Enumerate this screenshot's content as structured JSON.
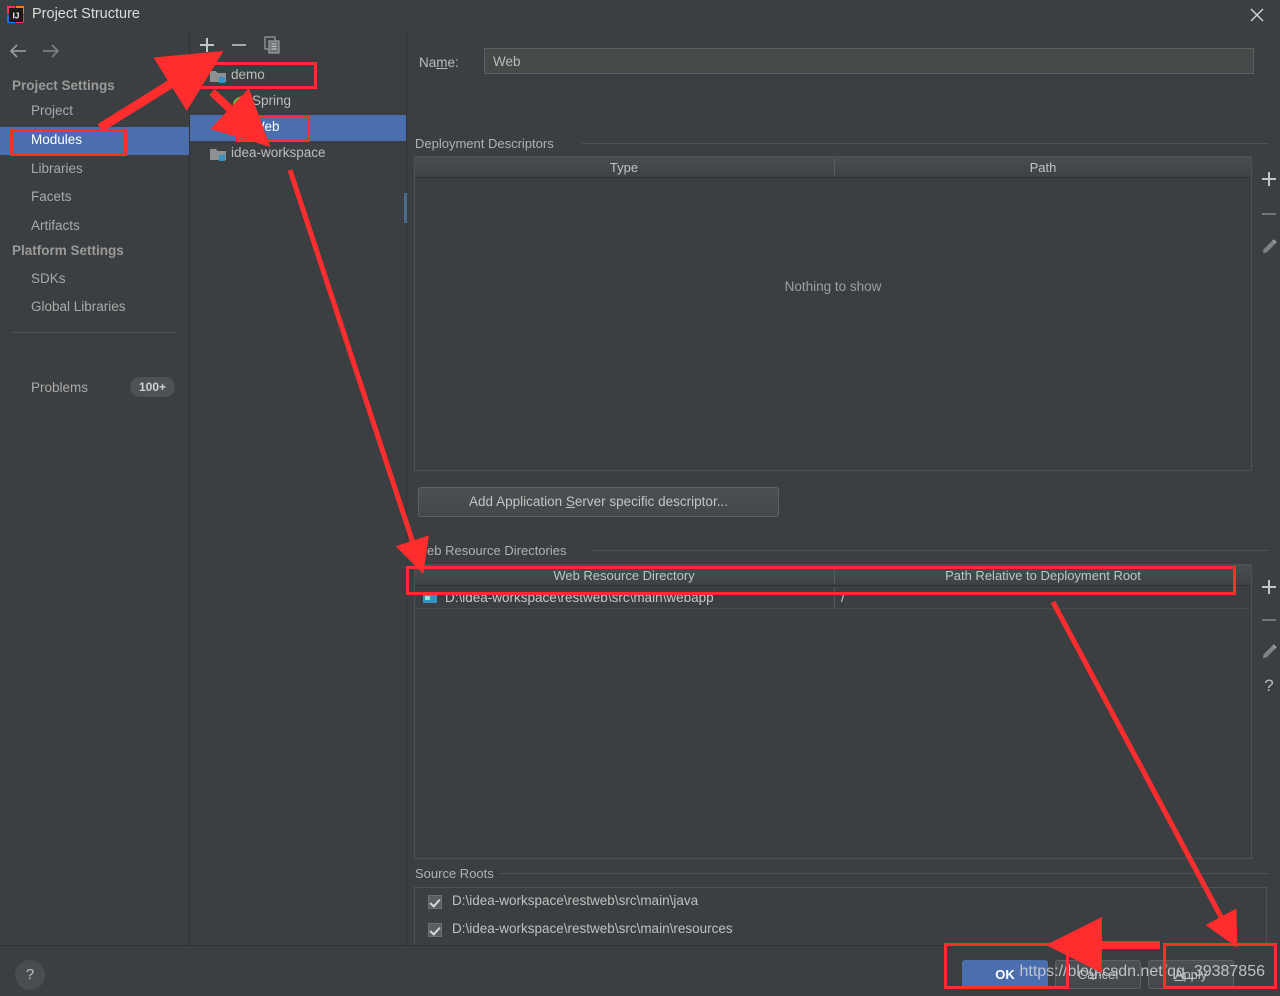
{
  "window": {
    "title": "Project Structure",
    "logo_icon": "intellij-idea-logo",
    "close_icon": "close-icon"
  },
  "sidebar": {
    "back_icon": "arrow-left-icon",
    "forward_icon": "arrow-right-icon",
    "groups": [
      {
        "label": "Project Settings"
      },
      {
        "label": "Platform Settings"
      }
    ],
    "items": [
      {
        "label": "Project",
        "selected": false
      },
      {
        "label": "Modules",
        "selected": true
      },
      {
        "label": "Libraries",
        "selected": false
      },
      {
        "label": "Facets",
        "selected": false
      },
      {
        "label": "Artifacts",
        "selected": false
      },
      {
        "label": "SDKs",
        "selected": false
      },
      {
        "label": "Global Libraries",
        "selected": false
      }
    ],
    "problems": {
      "label": "Problems",
      "count": "100+"
    }
  },
  "tree": {
    "toolbar": {
      "add_icon": "plus-icon",
      "remove_icon": "minus-icon",
      "copy_icon": "copy-icon"
    },
    "nodes": [
      {
        "label": "demo",
        "icon": "module-folder-icon",
        "expanded": true,
        "depth": 0,
        "selected": false
      },
      {
        "label": "Spring",
        "icon": "spring-leaf-icon",
        "expanded": null,
        "depth": 1,
        "selected": false
      },
      {
        "label": "Web",
        "icon": "web-facet-icon",
        "expanded": null,
        "depth": 1,
        "selected": true
      },
      {
        "label": "idea-workspace",
        "icon": "module-folder-icon",
        "expanded": null,
        "depth": 0,
        "selected": false
      }
    ]
  },
  "main": {
    "name_label": "Name:",
    "name_label_mnemonic": "m",
    "name_value": "Web",
    "deployment_descriptors": {
      "section_title": "Deployment Descriptors",
      "columns": [
        "Type",
        "Path"
      ],
      "rows": [],
      "empty_message": "Nothing to show",
      "toolbar": [
        {
          "icon": "plus-icon",
          "name": "add"
        },
        {
          "icon": "minus-icon",
          "name": "remove"
        },
        {
          "icon": "pencil-icon",
          "name": "edit"
        }
      ]
    },
    "add_descriptor_button": {
      "label": "Add Application Server specific descriptor...",
      "mnemonic": "S"
    },
    "web_resource_directories": {
      "section_title": "Web Resource Directories",
      "columns": [
        "Web Resource Directory",
        "Path Relative to Deployment Root"
      ],
      "rows": [
        {
          "icon": "folder-icon",
          "directory": "D:\\idea-workspace\\restweb\\src\\main\\webapp",
          "relative_path": "/"
        }
      ],
      "toolbar": [
        {
          "icon": "plus-icon",
          "name": "add"
        },
        {
          "icon": "minus-icon",
          "name": "remove"
        },
        {
          "icon": "pencil-icon",
          "name": "edit"
        },
        {
          "icon": "question-icon",
          "name": "help"
        }
      ]
    },
    "source_roots": {
      "section_title": "Source Roots",
      "items": [
        {
          "checked": true,
          "label": "D:\\idea-workspace\\restweb\\src\\main\\java"
        },
        {
          "checked": true,
          "label": "D:\\idea-workspace\\restweb\\src\\main\\resources"
        }
      ]
    }
  },
  "footer": {
    "help_icon": "question-icon",
    "buttons": [
      {
        "label": "OK",
        "style": "primary"
      },
      {
        "label": "Cancel",
        "style": "normal"
      },
      {
        "label": "Apply",
        "style": "normal",
        "mnemonic": "A"
      }
    ]
  },
  "overlay": {
    "watermark": "https://blog.csdn.net/qq_39387856",
    "accent_color": "#ff2d2d",
    "annotations": [
      {
        "name": "modules-highlight"
      },
      {
        "name": "demo-node-highlight"
      },
      {
        "name": "web-node-highlight"
      },
      {
        "name": "webapp-row-highlight"
      },
      {
        "name": "ok-button-highlight"
      },
      {
        "name": "apply-button-highlight"
      }
    ]
  },
  "theme": {
    "background": "#3c3f41",
    "selection": "#4b6eaf",
    "text": "#bbbbbb",
    "border": "#4f5254"
  }
}
